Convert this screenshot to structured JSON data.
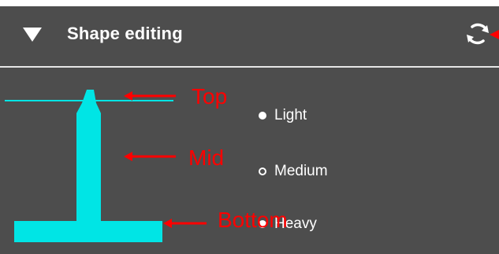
{
  "panel": {
    "title": "Shape editing",
    "icons": {
      "collapse": "collapse-triangle-icon",
      "refresh": "refresh-icon"
    },
    "colors": {
      "background": "#4d4d4d",
      "text": "#ffffff",
      "shape": "#00e5e5",
      "annotation": "#ff0000"
    }
  },
  "options": [
    {
      "label": "Light",
      "selected": false
    },
    {
      "label": "Medium",
      "selected": true
    },
    {
      "label": "Heavy",
      "selected": false
    }
  ],
  "annotations": {
    "top": "Top",
    "mid": "Mid",
    "bottom": "Bottom"
  }
}
